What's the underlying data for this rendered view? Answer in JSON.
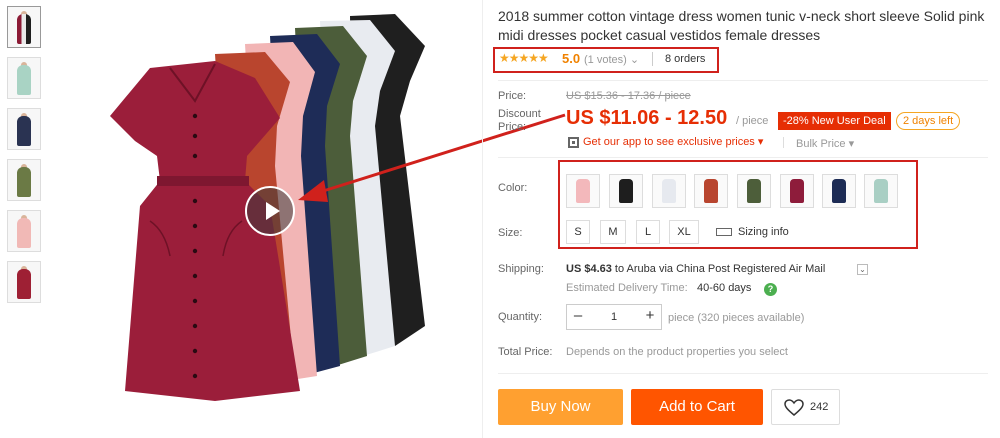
{
  "gallery": {
    "thumbnails": [
      {
        "name": "multi-color",
        "color": "#8b1a35"
      },
      {
        "name": "mint",
        "color": "#a9d3c4"
      },
      {
        "name": "navy",
        "color": "#2a3352"
      },
      {
        "name": "army-green",
        "color": "#6b7a45"
      },
      {
        "name": "pink",
        "color": "#f1b9b6"
      },
      {
        "name": "wine",
        "color": "#9e2034"
      }
    ]
  },
  "product": {
    "title": "2018 summer cotton vintage dress women tunic v-neck short sleeve Solid pink midi dresses pocket casual vestidos female dresses"
  },
  "rating": {
    "stars": "★★★★★",
    "value": "5.0",
    "votes": "(1 votes)",
    "votes_dropdown": "⌄",
    "orders": "8 orders"
  },
  "price": {
    "label": "Price:",
    "original": "US $15.36 - 17.36 / piece",
    "discount_label_1": "Discount",
    "discount_label_2": "Price:",
    "current": "US $11.06 - 12.50",
    "unit": "/ piece",
    "deal_badge": "-28% New User Deal",
    "days_left": "2 days left",
    "app_promo": "Get our app to see exclusive prices ▾",
    "bulk": "Bulk Price ▾"
  },
  "sku": {
    "color_label": "Color:",
    "colors": [
      {
        "name": "pink",
        "hex": "#f3b8bb"
      },
      {
        "name": "black",
        "hex": "#1e1e1e"
      },
      {
        "name": "white",
        "hex": "#e6e9ef"
      },
      {
        "name": "rust",
        "hex": "#b8452f"
      },
      {
        "name": "army-green",
        "hex": "#4d5e3a"
      },
      {
        "name": "wine",
        "hex": "#8e1c3b"
      },
      {
        "name": "navy",
        "hex": "#1d2c55"
      },
      {
        "name": "mint",
        "hex": "#a9cfc4"
      }
    ],
    "size_label": "Size:",
    "sizes": [
      "S",
      "M",
      "L",
      "XL"
    ],
    "sizing_info": "Sizing info"
  },
  "shipping": {
    "label": "Shipping:",
    "cost": "US $4.63",
    "route": " to Aruba via China Post Registered Air Mail",
    "est_label": "Estimated Delivery Time:",
    "est_days": "40-60 days",
    "help": "?"
  },
  "quantity": {
    "label": "Quantity:",
    "minus": "–",
    "value": "1",
    "plus": "+",
    "note": "piece (320 pieces available)"
  },
  "total": {
    "label": "Total Price:",
    "note": "Depends on the product properties you select"
  },
  "actions": {
    "buy_now": "Buy Now",
    "add_to_cart": "Add to Cart",
    "wishlist_count": "242"
  },
  "colors": {
    "accent": "#e62e04",
    "annotation": "#d0211c",
    "buy_now": "#ffa030",
    "add_to_cart": "#ff5500"
  }
}
